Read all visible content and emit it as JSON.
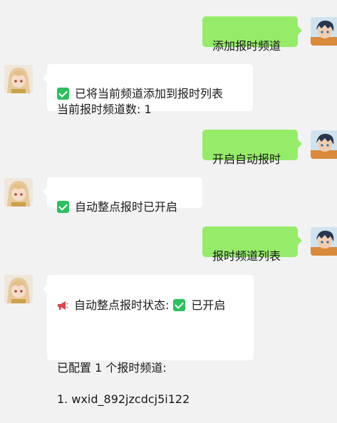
{
  "messages": [
    {
      "side": "right",
      "text": "添加报时频道"
    },
    {
      "side": "left",
      "line1": "已将当前频道添加到报时列表",
      "line2": "当前报时频道数: 1"
    },
    {
      "side": "right",
      "text": "开启自动报时"
    },
    {
      "side": "left",
      "text": "自动整点报时已开启"
    },
    {
      "side": "right",
      "text": "报时频道列表"
    },
    {
      "side": "left",
      "status_prefix": "自动整点报时状态:",
      "status_value": "已开启",
      "configured": "已配置 1 个报时频道:",
      "item1": "1. wxid_892jzcdcj5i122"
    }
  ],
  "colors": {
    "sent_bubble": "#95ec69",
    "received_bubble": "#ffffff",
    "background": "#f2f2f2",
    "check": "#2dbf5e"
  },
  "icons": {
    "check": "check-mark-icon",
    "megaphone": "megaphone-icon"
  }
}
